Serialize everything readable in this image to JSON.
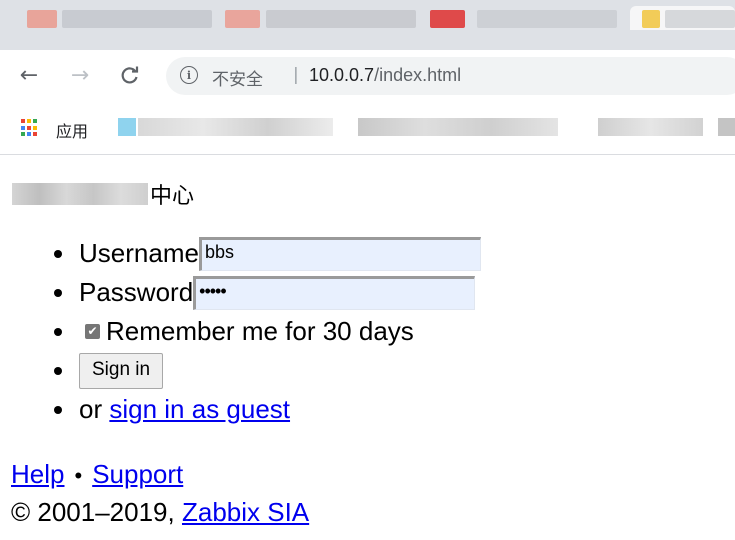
{
  "browser": {
    "url_security": "不安全",
    "url_separator": "|",
    "url_host": "10.0.0.7",
    "url_path": "/index.html",
    "back_glyph": "←",
    "forward_glyph": "→",
    "reload_glyph": "C",
    "info_glyph": "i",
    "bookmarks_apps_label": "应用"
  },
  "page": {
    "title_suffix": "中心",
    "username_label": "Username",
    "username_value": "bbs",
    "password_label": "Password",
    "password_value": "•••••",
    "remember_label": "Remember me for 30 days",
    "signin_label": "Sign in",
    "or_text": "or",
    "guest_link": "sign in as guest"
  },
  "footer": {
    "help_link": "Help",
    "separator": "•",
    "support_link": "Support",
    "copyright_prefix": "© 2001–2019,",
    "company_link": "Zabbix SIA"
  },
  "colors": {
    "link": "#0000ee",
    "input_autofill": "#e8f0fe"
  }
}
